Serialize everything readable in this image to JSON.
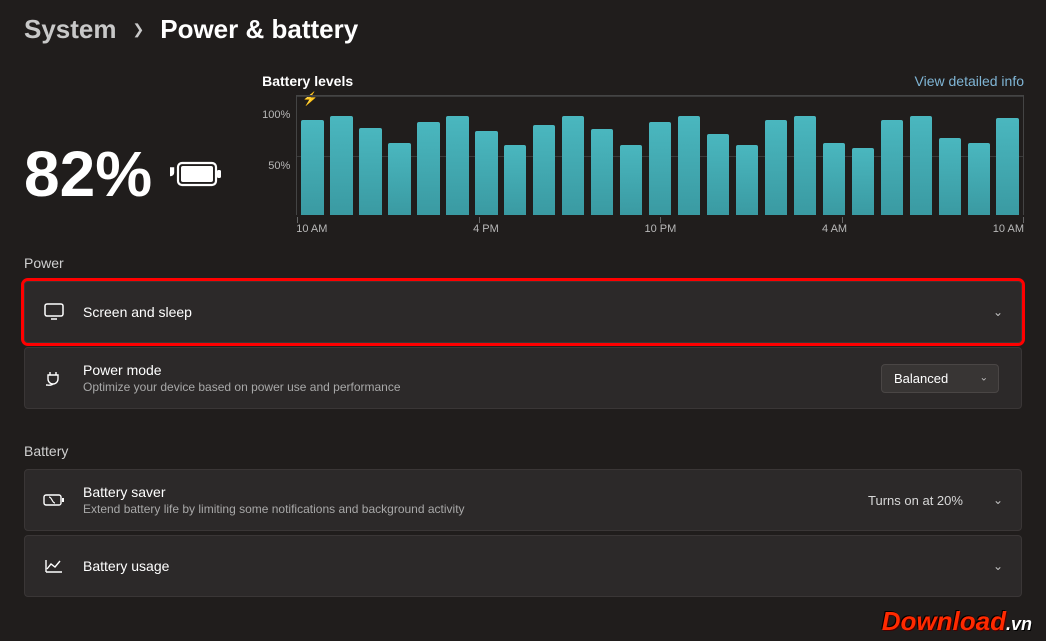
{
  "breadcrumb": {
    "parent": "System",
    "current": "Power & battery"
  },
  "battery": {
    "percent": "82%"
  },
  "chart": {
    "title": "Battery levels",
    "link": "View detailed info",
    "y100": "100%",
    "y50": "50%",
    "x": [
      "10 AM",
      "4 PM",
      "10 PM",
      "4 AM",
      "10 AM"
    ]
  },
  "chart_data": {
    "type": "bar",
    "title": "Battery levels",
    "ylabel": "%",
    "ylim": [
      0,
      100
    ],
    "x_range": [
      "10 AM",
      "10 AM (next day)"
    ],
    "x_tick_labels": [
      "10 AM",
      "4 PM",
      "10 PM",
      "4 AM",
      "10 AM"
    ],
    "values": [
      82,
      85,
      75,
      62,
      80,
      85,
      72,
      60,
      78,
      85,
      74,
      60,
      80,
      85,
      70,
      60,
      82,
      85,
      62,
      58,
      82,
      85,
      66,
      62,
      84
    ],
    "annotations": [
      {
        "type": "plug-icon",
        "at_index": 0
      }
    ]
  },
  "sections": {
    "power": "Power",
    "battery": "Battery"
  },
  "cards": {
    "screenSleep": {
      "title": "Screen and sleep"
    },
    "powerMode": {
      "title": "Power mode",
      "sub": "Optimize your device based on power use and performance",
      "value": "Balanced"
    },
    "batterySaver": {
      "title": "Battery saver",
      "sub": "Extend battery life by limiting some notifications and background activity",
      "value": "Turns on at 20%"
    },
    "batteryUsage": {
      "title": "Battery usage"
    }
  },
  "watermark": {
    "main": "Download",
    "tld": ".vn"
  }
}
